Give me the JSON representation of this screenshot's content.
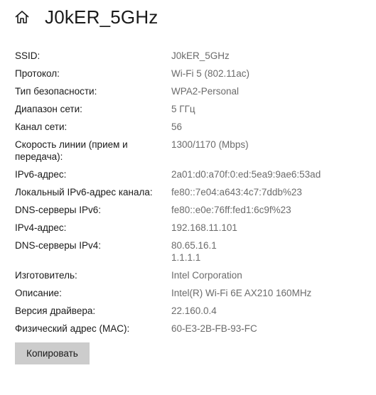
{
  "header": {
    "icon": "home-icon",
    "title": "J0kER_5GHz"
  },
  "properties": [
    {
      "label": "SSID:",
      "values": [
        "J0kER_5GHz"
      ]
    },
    {
      "label": "Протокол:",
      "values": [
        "Wi-Fi 5 (802.11ac)"
      ]
    },
    {
      "label": "Тип безопасности:",
      "values": [
        "WPA2-Personal"
      ]
    },
    {
      "label": "Диапазон сети:",
      "values": [
        "5 ГГц"
      ]
    },
    {
      "label": "Канал сети:",
      "values": [
        "56"
      ]
    },
    {
      "label": "Скорость линии (прием и передача):",
      "values": [
        "1300/1170 (Mbps)"
      ]
    },
    {
      "label": "IPv6-адрес:",
      "values": [
        "2a01:d0:a70f:0:ed:5ea9:9ae6:53ad"
      ]
    },
    {
      "label": "Локальный IPv6-адрес канала:",
      "values": [
        "fe80::7e04:a643:4c7:7ddb%23"
      ]
    },
    {
      "label": "DNS-серверы IPv6:",
      "values": [
        "fe80::e0e:76ff:fed1:6c9f%23"
      ]
    },
    {
      "label": "IPv4-адрес:",
      "values": [
        "192.168.11.101"
      ]
    },
    {
      "label": "DNS-серверы IPv4:",
      "values": [
        "80.65.16.1",
        "1.1.1.1"
      ]
    },
    {
      "label": "Изготовитель:",
      "values": [
        "Intel Corporation"
      ]
    },
    {
      "label": "Описание:",
      "values": [
        "Intel(R) Wi-Fi 6E AX210 160MHz"
      ]
    },
    {
      "label": "Версия драйвера:",
      "values": [
        "22.160.0.4"
      ]
    },
    {
      "label": "Физический адрес (MAC):",
      "values": [
        "60-E3-2B-FB-93-FC"
      ]
    }
  ],
  "copy_button": {
    "label": "Копировать"
  },
  "colors": {
    "label_text": "#1a1a1a",
    "value_text": "#6b6b6b",
    "button_bg": "#cccccc"
  }
}
